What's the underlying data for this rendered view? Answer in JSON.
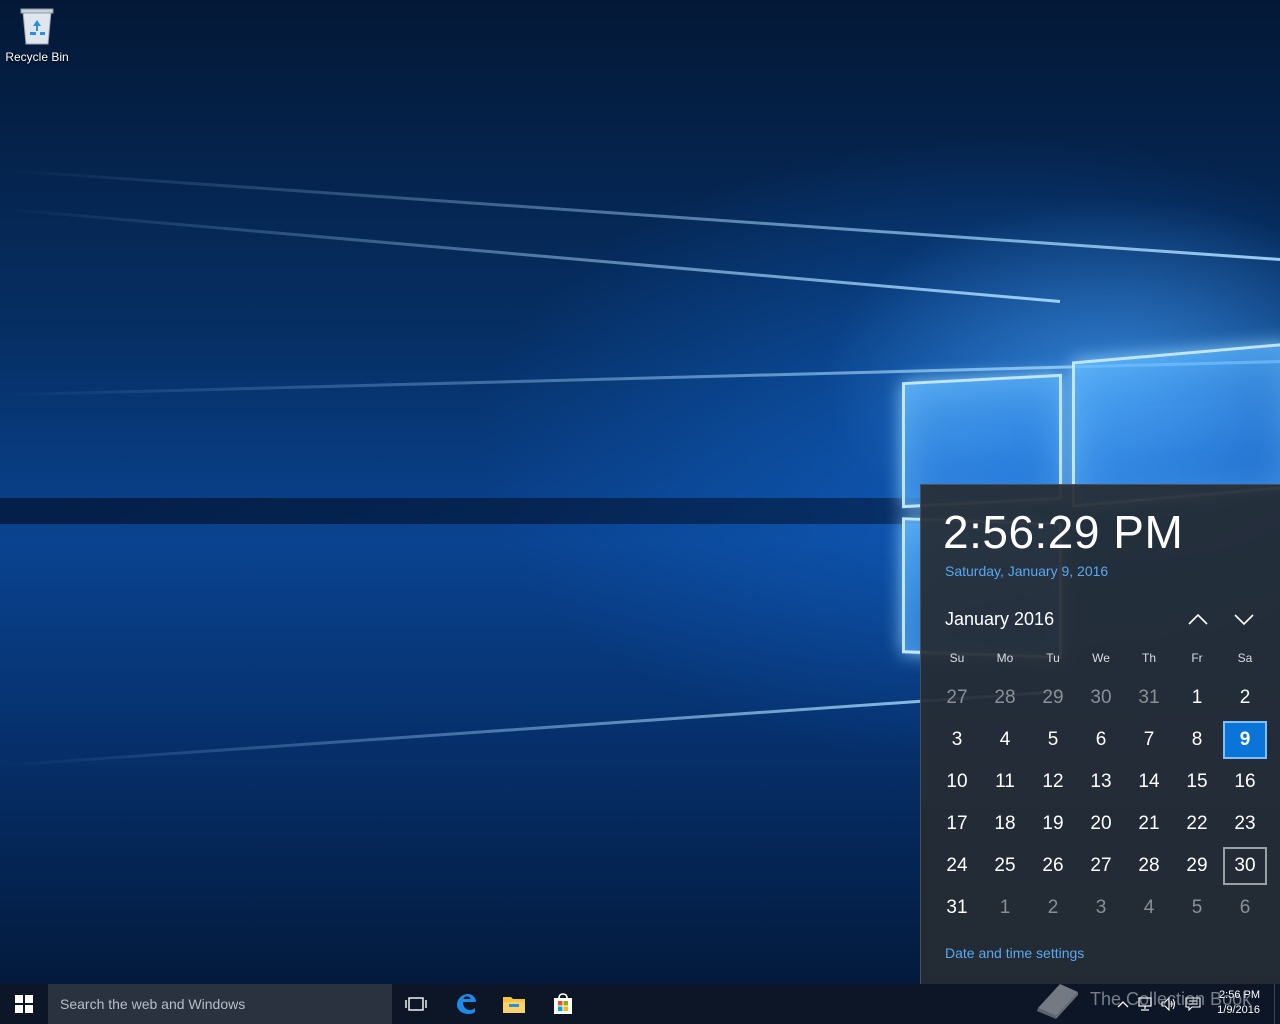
{
  "desktop": {
    "icons": [
      {
        "label": "Recycle Bin",
        "icon": "recycle-bin-icon"
      }
    ]
  },
  "flyout": {
    "time": "2:56:29 PM",
    "long_date": "Saturday, January 9, 2016",
    "month_title": "January 2016",
    "weekdays": [
      "Su",
      "Mo",
      "Tu",
      "We",
      "Th",
      "Fr",
      "Sa"
    ],
    "days": [
      {
        "label": "27",
        "state": "other-month"
      },
      {
        "label": "28",
        "state": "other-month"
      },
      {
        "label": "29",
        "state": "other-month"
      },
      {
        "label": "30",
        "state": "other-month"
      },
      {
        "label": "31",
        "state": "other-month"
      },
      {
        "label": "1",
        "state": "current-month"
      },
      {
        "label": "2",
        "state": "current-month"
      },
      {
        "label": "3",
        "state": "current-month"
      },
      {
        "label": "4",
        "state": "current-month"
      },
      {
        "label": "5",
        "state": "current-month"
      },
      {
        "label": "6",
        "state": "current-month"
      },
      {
        "label": "7",
        "state": "current-month"
      },
      {
        "label": "8",
        "state": "current-month"
      },
      {
        "label": "9",
        "state": "today"
      },
      {
        "label": "10",
        "state": "current-month"
      },
      {
        "label": "11",
        "state": "current-month"
      },
      {
        "label": "12",
        "state": "current-month"
      },
      {
        "label": "13",
        "state": "current-month"
      },
      {
        "label": "14",
        "state": "current-month"
      },
      {
        "label": "15",
        "state": "current-month"
      },
      {
        "label": "16",
        "state": "current-month"
      },
      {
        "label": "17",
        "state": "current-month"
      },
      {
        "label": "18",
        "state": "current-month"
      },
      {
        "label": "19",
        "state": "current-month"
      },
      {
        "label": "20",
        "state": "current-month"
      },
      {
        "label": "21",
        "state": "current-month"
      },
      {
        "label": "22",
        "state": "current-month"
      },
      {
        "label": "23",
        "state": "current-month"
      },
      {
        "label": "24",
        "state": "current-month"
      },
      {
        "label": "25",
        "state": "current-month"
      },
      {
        "label": "26",
        "state": "current-month"
      },
      {
        "label": "27",
        "state": "current-month"
      },
      {
        "label": "28",
        "state": "current-month"
      },
      {
        "label": "29",
        "state": "current-month"
      },
      {
        "label": "30",
        "state": "selected"
      },
      {
        "label": "31",
        "state": "current-month"
      },
      {
        "label": "1",
        "state": "other-month"
      },
      {
        "label": "2",
        "state": "other-month"
      },
      {
        "label": "3",
        "state": "other-month"
      },
      {
        "label": "4",
        "state": "other-month"
      },
      {
        "label": "5",
        "state": "other-month"
      },
      {
        "label": "6",
        "state": "other-month"
      }
    ],
    "settings_link": "Date and time settings",
    "nav": {
      "prev_icon": "chevron-up-icon",
      "next_icon": "chevron-down-icon"
    }
  },
  "taskbar": {
    "search_placeholder": "Search the web and Windows",
    "pinned": [
      {
        "name": "task-view",
        "icon": "task-view-icon"
      },
      {
        "name": "edge",
        "icon": "edge-icon"
      },
      {
        "name": "file-explorer",
        "icon": "folder-icon"
      },
      {
        "name": "store",
        "icon": "store-icon"
      }
    ],
    "tray": {
      "clock_time": "2:56 PM",
      "clock_date": "1/9/2016",
      "icons": [
        "chevron-up-icon",
        "network-icon",
        "volume-icon",
        "action-center-icon"
      ]
    }
  },
  "watermark": {
    "text": "The Collection Book"
  },
  "colors": {
    "accent": "#0a74d8",
    "link": "#5aa8ee",
    "flyout_bg": "#262c34",
    "taskbar_bg": "#0c1626"
  }
}
